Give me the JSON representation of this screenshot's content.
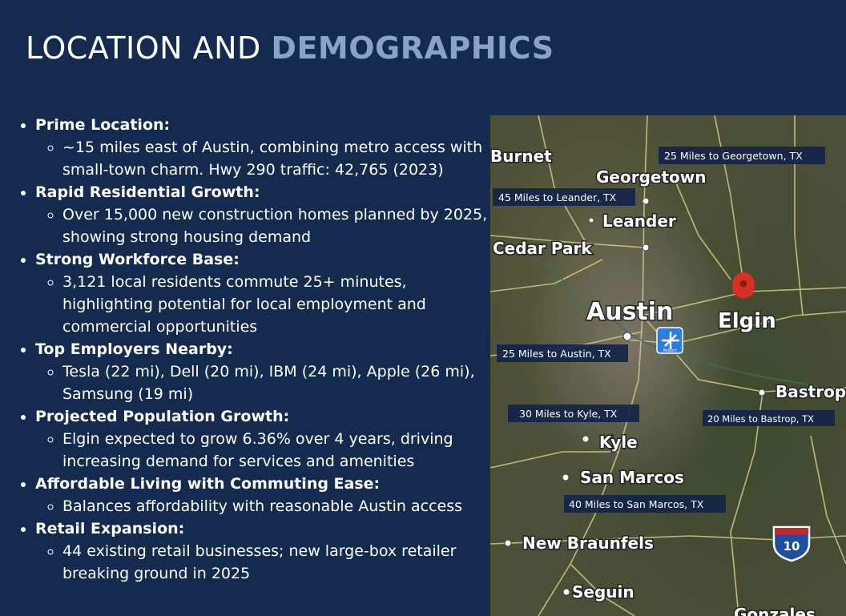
{
  "title": {
    "part1": "LOCATION AND ",
    "part2": "DEMOGRAPHICS"
  },
  "bullets": [
    {
      "head": "Prime Location:",
      "sub": [
        "~15 miles east of Austin, combining metro access with small-town charm. Hwy 290 traffic: 42,765 (2023)"
      ]
    },
    {
      "head": "Rapid Residential Growth:",
      "sub": [
        "Over 15,000 new construction homes planned by 2025, showing strong housing demand"
      ]
    },
    {
      "head": "Strong Workforce Base:",
      "sub": [
        "3,121 local residents commute 25+ minutes, highlighting potential for local employment and commercial opportunities"
      ]
    },
    {
      "head": "Top Employers Nearby:",
      "sub": [
        "Tesla (22 mi), Dell (20 mi), IBM (24 mi), Apple (26 mi), Samsung (19 mi)"
      ]
    },
    {
      "head": "Projected Population Growth:",
      "sub": [
        "Elgin expected to grow 6.36% over 4 years, driving increasing demand for services and amenities"
      ]
    },
    {
      "head": "Affordable Living with Commuting Ease:",
      "sub": [
        " Balances affordability with reasonable Austin access"
      ]
    },
    {
      "head": "Retail Expansion:",
      "sub": [
        "44 existing retail businesses; new large-box retailer breaking ground in 2025"
      ]
    }
  ],
  "map": {
    "cities": {
      "burnet": "Burnet",
      "georgetown": "Georgetown",
      "leander": "Leander",
      "cedar_park": "Cedar Park",
      "austin": "Austin",
      "elgin": "Elgin",
      "bastrop": "Bastrop",
      "kyle": "Kyle",
      "san_marcos": "San Marcos",
      "new_braunfels": "New Braunfels",
      "seguin": "Seguin",
      "gonzales": "Gonzales"
    },
    "distances": {
      "georgetown": "25 Miles to Georgetown, TX",
      "leander": "45 Miles to Leander, TX",
      "austin": "25 Miles to Austin, TX",
      "kyle": "30 Miles to Kyle, TX",
      "bastrop": "20 Miles to Bastrop, TX",
      "san_marcos": "40 Miles to San Marcos, TX"
    },
    "airport_label": "Airport",
    "interstate_number": "10",
    "pin_color": "#d93025"
  }
}
